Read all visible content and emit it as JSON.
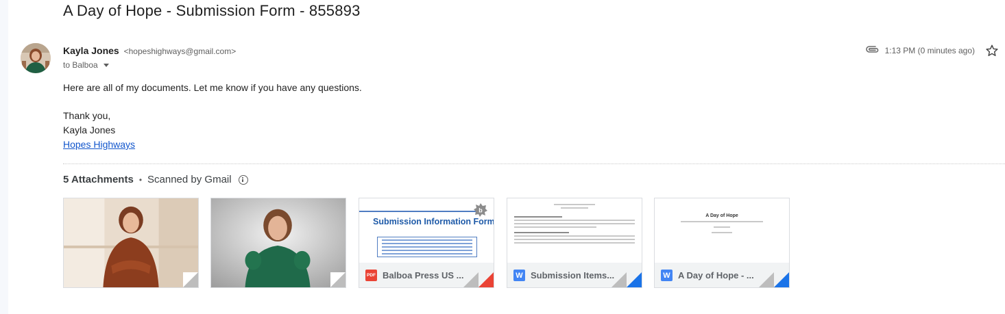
{
  "subject": "A Day of Hope - Submission Form - 855893",
  "sender": {
    "name": "Kayla Jones",
    "email": "<hopeshighways@gmail.com>",
    "to_label": "to Balboa"
  },
  "meta": {
    "time": "1:13 PM (0 minutes ago)"
  },
  "body": {
    "line1": "Here are all of my documents. Let me know if you have any questions.",
    "thanks": "Thank you,",
    "signature": "Kayla Jones",
    "link": "Hopes Highways"
  },
  "attachments": {
    "count_label": "5 Attachments",
    "dot": "•",
    "scanned_label": "Scanned by Gmail",
    "files": [
      {
        "kind": "photo"
      },
      {
        "kind": "photo"
      },
      {
        "kind": "pdf",
        "name": "Balboa Press US ...",
        "preview_title": "Submission Information Form"
      },
      {
        "kind": "word",
        "name": "Submission Items..."
      },
      {
        "kind": "word",
        "name": "A Day of Hope - ...",
        "preview_title": "A Day of Hope"
      }
    ]
  },
  "icons": {
    "star": "star-icon",
    "attachment": "paperclip-icon",
    "info": "info-icon",
    "caret": "chevron-down-icon",
    "pdf": "pdf-file-icon",
    "word": "word-file-icon"
  },
  "colors": {
    "link": "#1155cc",
    "pdf_red": "#ea4335",
    "word_blue": "#1a73e8"
  }
}
